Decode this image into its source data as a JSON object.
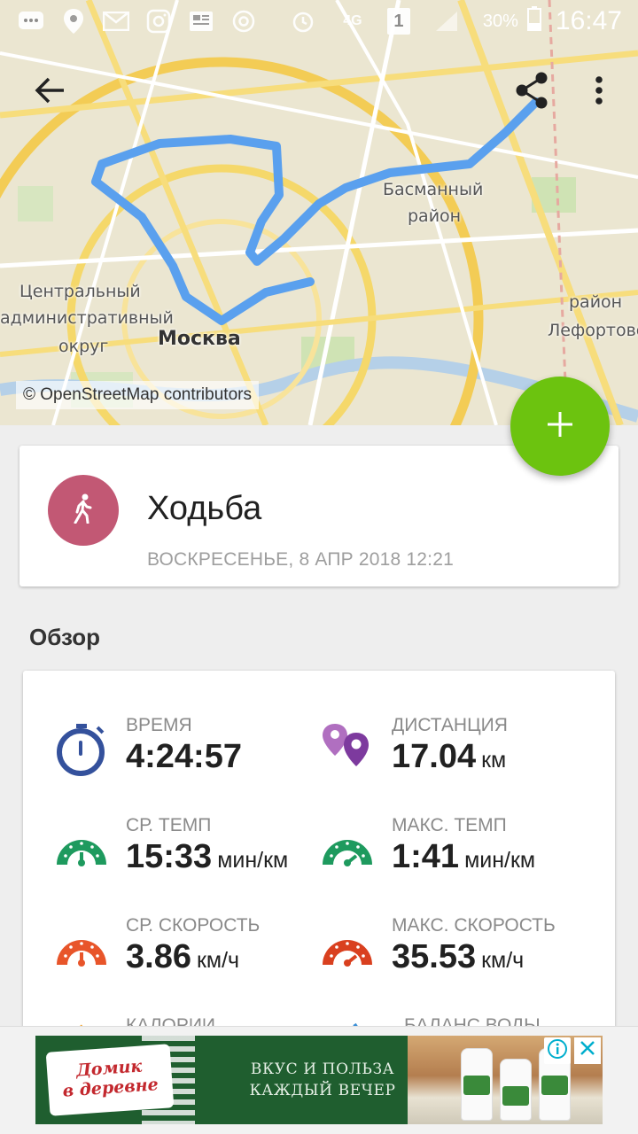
{
  "status_bar": {
    "time": "16:47",
    "battery": "30%",
    "network": "4G",
    "sim": "1",
    "icons": [
      "message-icon",
      "location-icon",
      "mail-icon",
      "instagram-icon",
      "news-icon",
      "at-icon",
      "alarm-icon"
    ]
  },
  "toolbar": {
    "back_icon": "arrow-left-icon",
    "share_icon": "share-icon",
    "menu_icon": "more-vert-icon"
  },
  "map": {
    "labels": {
      "basmanny_1": "Басманный",
      "basmanny_2": "район",
      "central_1": "Центральный",
      "central_2": "административный",
      "central_3": "округ",
      "moscow": "Москва",
      "right_1": "район",
      "right_2": "Лефортово"
    },
    "attribution": "© OpenStreetMap contributors",
    "route_color": "#5aa0ee"
  },
  "fab": {
    "icon": "plus-icon",
    "color": "#6cc30f"
  },
  "activity": {
    "icon": "walking-icon",
    "icon_color": "#c25874",
    "title": "Ходьба",
    "date": "ВОСКРЕСЕНЬЕ, 8 АПР 2018 12:21"
  },
  "overview": {
    "title": "Обзор",
    "stats": [
      {
        "label": "ВРЕМЯ",
        "value": "4:24:57",
        "unit": "",
        "icon": "stopwatch-icon"
      },
      {
        "label": "ДИСТАНЦИЯ",
        "value": "17.04",
        "unit": "км",
        "icon": "distance-pins-icon"
      },
      {
        "label": "СР. ТЕМП",
        "value": "15:33",
        "unit": "мин/км",
        "icon": "avg-pace-gauge-icon"
      },
      {
        "label": "МАКС. ТЕМП",
        "value": "1:41",
        "unit": "мин/км",
        "icon": "max-pace-gauge-icon"
      },
      {
        "label": "СР. СКОРОСТЬ",
        "value": "3.86",
        "unit": "км/ч",
        "icon": "avg-speed-gauge-icon"
      },
      {
        "label": "МАКС. СКОРОСТЬ",
        "value": "35.53",
        "unit": "км/ч",
        "icon": "max-speed-gauge-icon"
      },
      {
        "label": "КАЛОРИИ",
        "value": "",
        "unit": "",
        "icon": "calories-icon"
      },
      {
        "label": "БАЛАНС ВОДЫ",
        "value": "",
        "unit": "",
        "icon": "water-icon"
      }
    ]
  },
  "ad": {
    "brand_1": "Домик",
    "brand_2": "в деревне",
    "slogan_1": "ВКУС И ПОЛЬЗА",
    "slogan_2": "КАЖДЫЙ ВЕЧЕР",
    "info_icon": "info-icon",
    "close_icon": "close-icon"
  }
}
